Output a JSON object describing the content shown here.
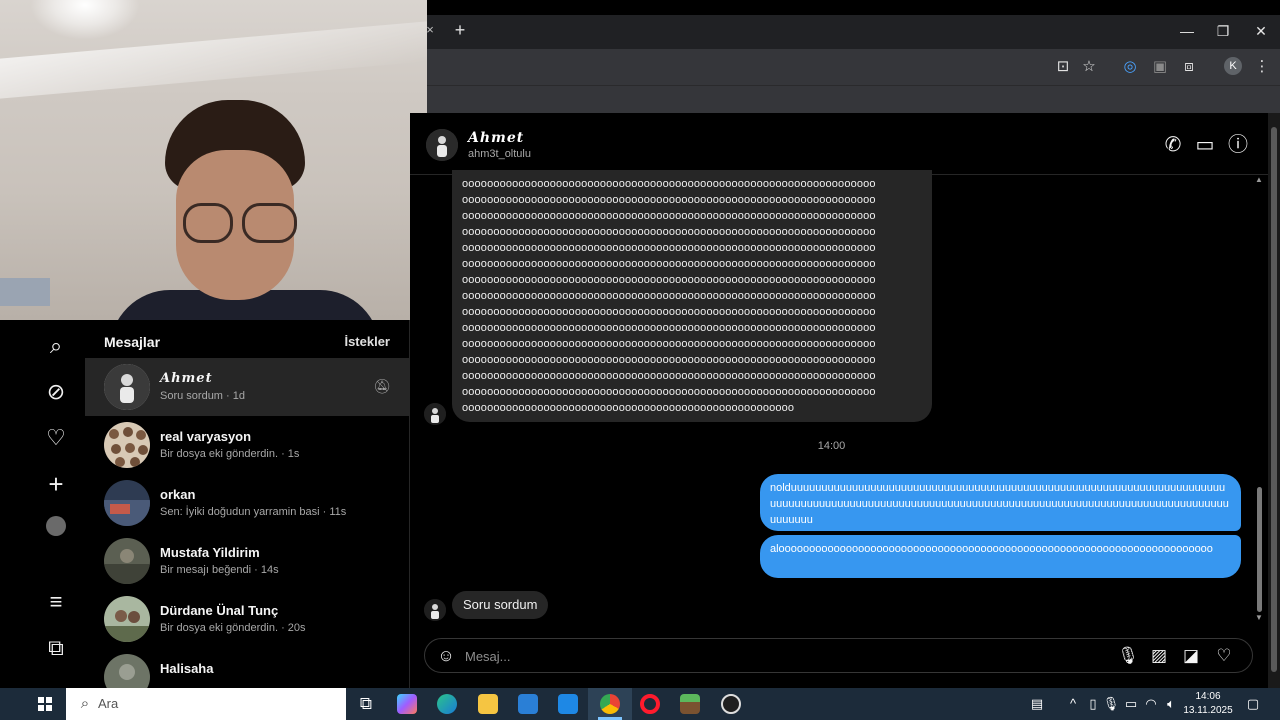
{
  "browser": {
    "tab_close_glyph": "×",
    "new_tab_glyph": "+",
    "profile_initial": "K"
  },
  "nav": {
    "items": [
      {
        "name": "search-icon",
        "glyph": "⌕"
      },
      {
        "name": "explore-icon",
        "glyph": "⊘"
      },
      {
        "name": "heart-icon",
        "glyph": "♡"
      },
      {
        "name": "plus-icon",
        "glyph": "+"
      },
      {
        "name": "profile-avatar",
        "glyph": ""
      },
      {
        "name": "menu-icon",
        "glyph": "≡"
      },
      {
        "name": "apps-icon",
        "glyph": "⧉"
      }
    ]
  },
  "messages": {
    "title": "Mesajlar",
    "requests_label": "İstekler",
    "conversations": [
      {
        "name": "Ahmet",
        "preview": "Soru sordum · 1d",
        "muted": true,
        "active": true,
        "avatar_color": "#cfcfcf"
      },
      {
        "name": "real varyasyon",
        "preview": "Bir dosya eki gönderdin. · 1s",
        "avatar_color": "#8a6a52"
      },
      {
        "name": "orkan",
        "preview": "Sen: İyiki doğudun yarramin basi · 11s",
        "avatar_color": "#4a5a78"
      },
      {
        "name": "Mustafa Yildirim",
        "preview": "Bir mesajı beğendi · 14s",
        "avatar_color": "#5b5f52"
      },
      {
        "name": "Dürdane Ünal Tunç",
        "preview": "Bir dosya eki gönderdin. · 20s",
        "avatar_color": "#6f7a5e"
      },
      {
        "name": "Halisaha",
        "preview": "",
        "avatar_color": "#6d7466"
      }
    ]
  },
  "chat": {
    "contact_name": "Ahmet",
    "contact_username": "ahm3t_oltulu",
    "incoming_long_lines": [
      "oooooooooooooooooooooooooooooooooooooooooooooooooooooooooooooooooo",
      "oooooooooooooooooooooooooooooooooooooooooooooooooooooooooooooooooo",
      "oooooooooooooooooooooooooooooooooooooooooooooooooooooooooooooooooo",
      "oooooooooooooooooooooooooooooooooooooooooooooooooooooooooooooooooo",
      "oooooooooooooooooooooooooooooooooooooooooooooooooooooooooooooooooo",
      "oooooooooooooooooooooooooooooooooooooooooooooooooooooooooooooooooo",
      "oooooooooooooooooooooooooooooooooooooooooooooooooooooooooooooooooo",
      "oooooooooooooooooooooooooooooooooooooooooooooooooooooooooooooooooo",
      "oooooooooooooooooooooooooooooooooooooooooooooooooooooooooooooooooo",
      "oooooooooooooooooooooooooooooooooooooooooooooooooooooooooooooooooo",
      "oooooooooooooooooooooooooooooooooooooooooooooooooooooooooooooooooo",
      "oooooooooooooooooooooooooooooooooooooooooooooooooooooooooooooooooo",
      "oooooooooooooooooooooooooooooooooooooooooooooooooooooooooooooooooo",
      "oooooooooooooooooooooooooooooooooooooooooooooooooooooooooooooooooo",
      "ooooooooooooooooooooooooooooooooooooooooooooooooooooo"
    ],
    "timestamp": "14:00",
    "outgoing": [
      "nolduuuuuuuuuuuuuuuuuuuuuuuuuuuuuuuuuuuuuuuuuuuuuuuuuuuuuuuuuuuuuuuuuuuuuuuuuuuuuuuuuuuuuuuuuuuuuuuuuuuuuuuuuuuuuuuuuuuuuuuuuuuuuuuuuuuuuuuuuuuuuuuuuuuuuuuuu",
      "alooooooooooooooooooooooooooooooooooooooooooooooooooooooooooooooooooooooo"
    ],
    "incoming_short": "Soru sordum",
    "composer_placeholder": "Mesaj..."
  },
  "taskbar": {
    "search_placeholder": "Ara",
    "time": "14:06",
    "date": "13.11.2025"
  },
  "colors": {
    "outgoing_bubble": "#3797f0",
    "incoming_bubble": "#262626",
    "background": "#000000",
    "taskbar": "#1c2b3a"
  }
}
